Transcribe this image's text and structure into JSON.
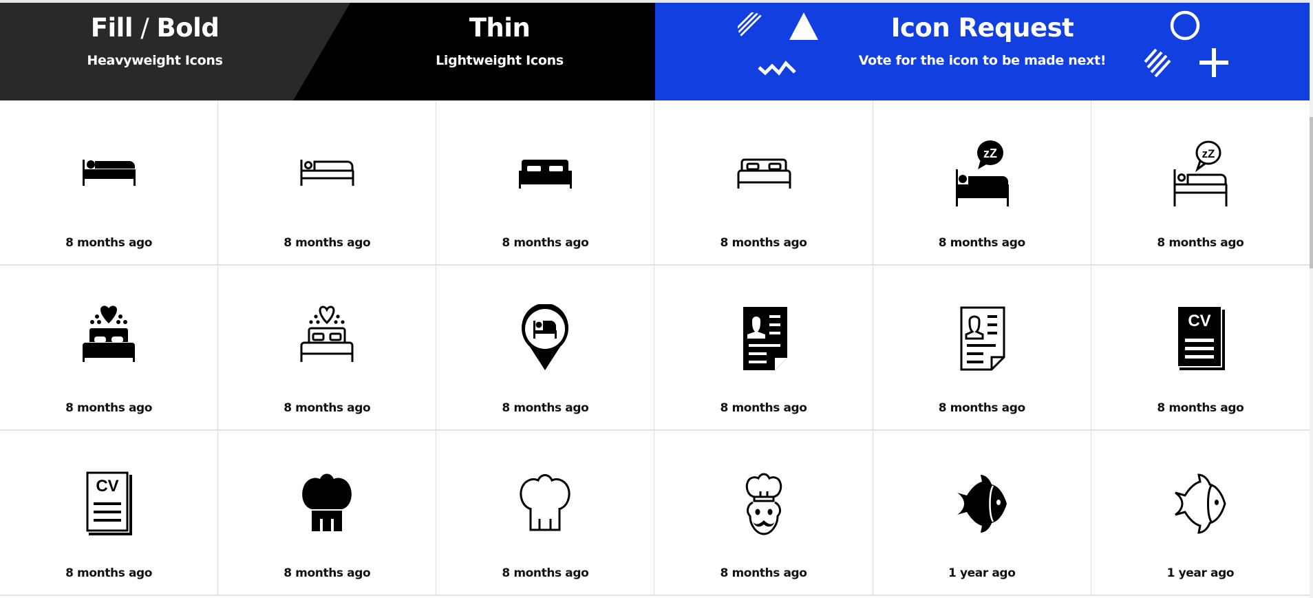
{
  "colors": {
    "fill_panel": "#28292b",
    "thin_panel": "#000000",
    "request_panel": "#113fe0",
    "text": "#111111"
  },
  "header": {
    "fill": {
      "title_left": "Fill",
      "title_slash": " / ",
      "title_right": "Bold",
      "subtitle": "Heavyweight Icons"
    },
    "thin": {
      "title": "Thin",
      "subtitle": "Lightweight Icons"
    },
    "request": {
      "title": "Icon Request",
      "subtitle": "Vote for the icon to be made next!"
    }
  },
  "icons": [
    {
      "name": "bed-person-fill",
      "time": "8 months ago"
    },
    {
      "name": "bed-person-thin",
      "time": "8 months ago"
    },
    {
      "name": "double-bed-fill",
      "time": "8 months ago"
    },
    {
      "name": "double-bed-thin",
      "time": "8 months ago"
    },
    {
      "name": "sleeping-zz-fill",
      "time": "8 months ago"
    },
    {
      "name": "sleeping-zz-thin",
      "time": "8 months ago"
    },
    {
      "name": "honeymoon-bed-fill",
      "time": "8 months ago"
    },
    {
      "name": "honeymoon-bed-thin",
      "time": "8 months ago"
    },
    {
      "name": "hotel-location-pin",
      "time": "8 months ago"
    },
    {
      "name": "resume-fill",
      "time": "8 months ago"
    },
    {
      "name": "resume-thin",
      "time": "8 months ago"
    },
    {
      "name": "cv-fill",
      "time": "8 months ago"
    },
    {
      "name": "cv-thin",
      "time": "8 months ago"
    },
    {
      "name": "chef-hat-fill",
      "time": "8 months ago"
    },
    {
      "name": "chef-hat-thin",
      "time": "8 months ago"
    },
    {
      "name": "chef-face",
      "time": "8 months ago"
    },
    {
      "name": "fish-fill",
      "time": "1 year ago"
    },
    {
      "name": "fish-thin",
      "time": "1 year ago"
    }
  ]
}
